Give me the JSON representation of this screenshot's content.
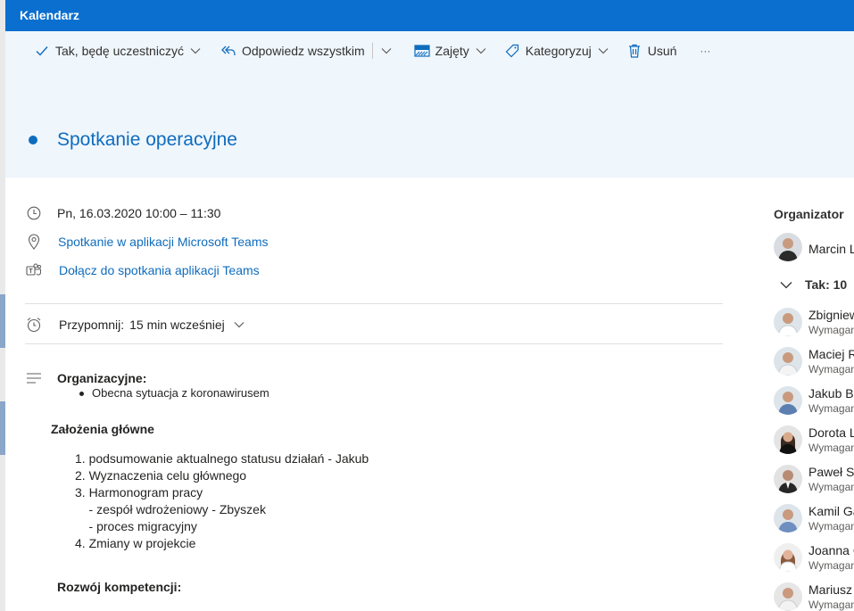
{
  "window": {
    "title": "Kalendarz"
  },
  "toolbar": {
    "accept_label": "Tak, będę uczestniczyć",
    "reply_all_label": "Odpowiedz wszystkim",
    "busy_label": "Zajęty",
    "categorize_label": "Kategoryzuj",
    "delete_label": "Usuń",
    "more_label": "···"
  },
  "event": {
    "title": "Spotkanie operacyjne",
    "datetime": "Pn, 16.03.2020 10:00 – 11:30",
    "location": "Spotkanie w aplikacji Microsoft Teams",
    "join_link": "Dołącz do spotkania aplikacji Teams",
    "reminder_label": "Przypomnij:",
    "reminder_value": "15 min wcześniej"
  },
  "body": {
    "section1_heading": "Organizacyjne:",
    "section1_bullet": "Obecna sytuacja z koronawirusem",
    "section2_heading": "Założenia główne",
    "list": [
      "1. podsumowanie aktualnego statusu działań - Jakub",
      "2. Wyznaczenia celu głównego",
      "3. Harmonogram pracy",
      "    - zespół wdrożeniowy - Zbyszek",
      "    - proces migracyjny",
      "4. Zmiany w projekcie"
    ],
    "section3_heading": "Rozwój kompetencji:"
  },
  "attendees": {
    "organizer_label": "Organizator",
    "organizer_name": "Marcin L",
    "accepted_label": "Tak: 10",
    "people": [
      {
        "name": "Zbigniew",
        "role": "Wymagan"
      },
      {
        "name": "Maciej R",
        "role": "Wymagan"
      },
      {
        "name": "Jakub Bi",
        "role": "Wymagan"
      },
      {
        "name": "Dorota L",
        "role": "Wymagan"
      },
      {
        "name": "Paweł Sk",
        "role": "Wymagan"
      },
      {
        "name": "Kamil Ga",
        "role": "Wymagan"
      },
      {
        "name": "Joanna C",
        "role": "Wymagan"
      },
      {
        "name": "Mariusz",
        "role": "Wymagan"
      }
    ]
  },
  "colors": {
    "titlebar": "#0a6fcf",
    "accent": "#0f6cbd",
    "header_bg": "#eff6fc"
  }
}
